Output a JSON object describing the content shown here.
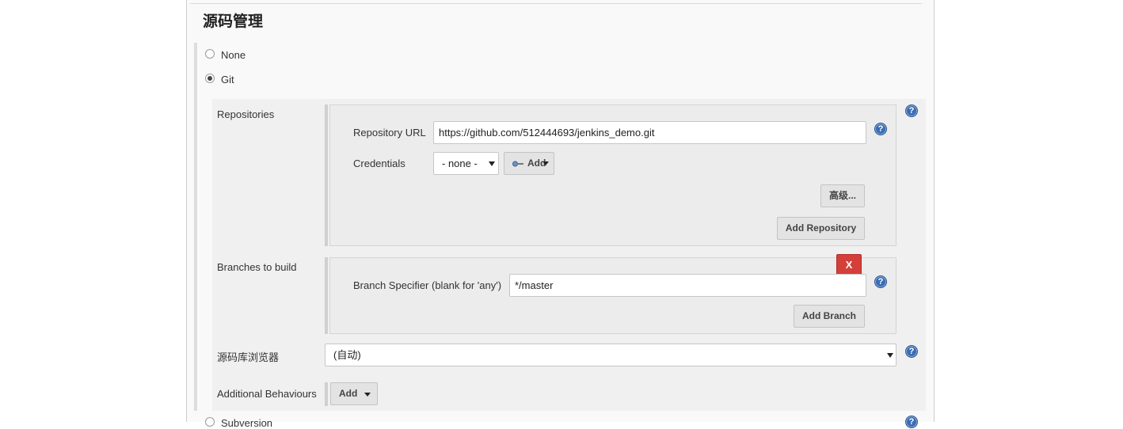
{
  "section": {
    "title": "源码管理"
  },
  "scm_options": [
    {
      "label": "None",
      "checked": false
    },
    {
      "label": "Git",
      "checked": true
    },
    {
      "label": "Subversion",
      "checked": false
    }
  ],
  "repositories": {
    "label": "Repositories",
    "url_label": "Repository URL",
    "url_value": "https://github.com/512444693/jenkins_demo.git",
    "credentials_label": "Credentials",
    "credentials_value": "- none -",
    "add_credentials_label": "Add",
    "advanced_label": "高级...",
    "add_repository_label": "Add Repository"
  },
  "branches": {
    "label": "Branches to build",
    "delete_label": "X",
    "specifier_label": "Branch Specifier (blank for 'any')",
    "specifier_value": "*/master",
    "add_branch_label": "Add Branch"
  },
  "browser": {
    "label": "源码库浏览器",
    "value": "(自动)"
  },
  "behaviours": {
    "label": "Additional Behaviours",
    "add_label": "Add"
  },
  "help_icon_glyph": "?",
  "colors": {
    "danger": "#d43f3a",
    "help": "#3c6cb2"
  }
}
